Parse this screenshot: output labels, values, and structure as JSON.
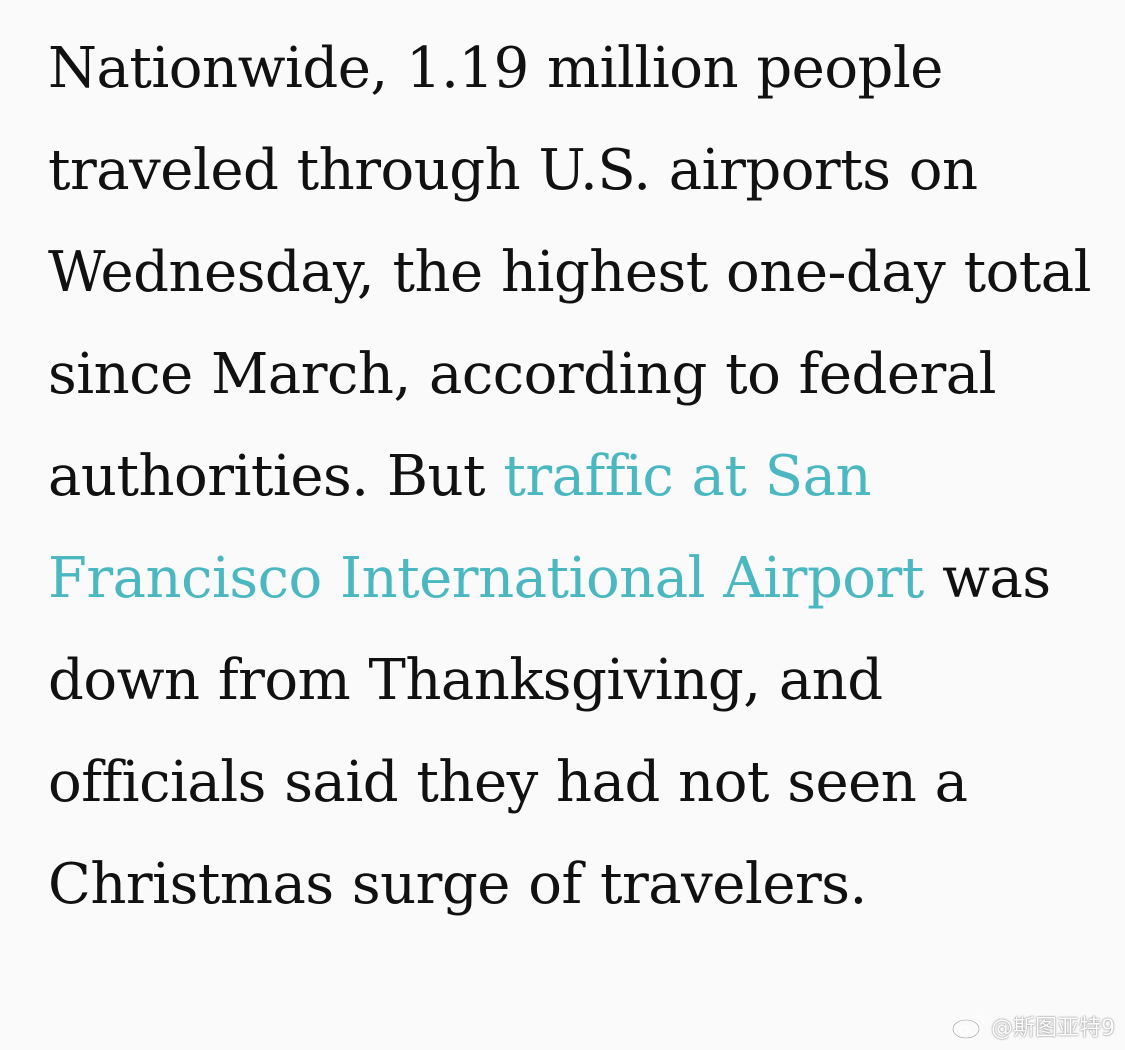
{
  "article": {
    "text_before_link": "Nationwide, 1.19 million people traveled through U.S. airports on Wednesday, the highest one-day total since March, according to federal authorities. But ",
    "link_text": "traffic at San Francisco International Airport",
    "text_after_link": " was down from Thanksgiving, and officials said they had not seen a Christmas surge of travelers."
  },
  "watermark": {
    "handle": "@斯图亚特9",
    "logo_icon": "weibo-logo-icon"
  },
  "colors": {
    "text": "#111111",
    "link": "#4bb8c1",
    "background": "#fafafa"
  }
}
